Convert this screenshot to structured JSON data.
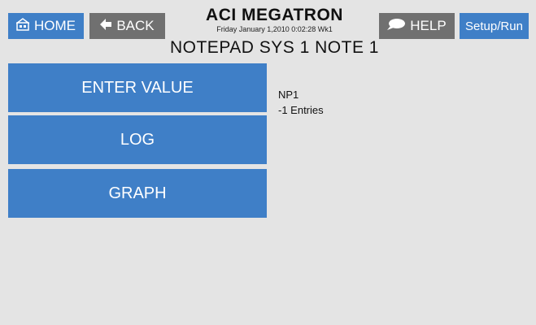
{
  "header": {
    "home_label": "HOME",
    "back_label": "BACK",
    "help_label": "HELP",
    "setup_label": "Setup/Run",
    "title": "ACI MEGATRON",
    "datetime": "Friday January 1,2010 0:02:28 Wk1",
    "subtitle": "NOTEPAD SYS 1 NOTE 1",
    "icons": {
      "home": "home-icon",
      "back": "arrow-left-icon",
      "help": "speech-bubble-icon"
    }
  },
  "menu": {
    "enter_value": "ENTER VALUE",
    "log": "LOG",
    "graph": "GRAPH"
  },
  "info": {
    "name": "NP1",
    "entries": "-1 Entries"
  },
  "colors": {
    "accent": "#3f7fc7",
    "button_gray": "#707070",
    "background": "#e4e4e4"
  }
}
